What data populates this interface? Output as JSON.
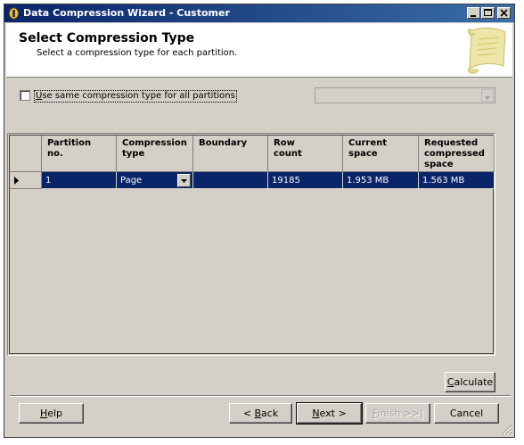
{
  "window": {
    "title": "Data Compression Wizard - Customer",
    "controls": [
      "minimize-icon",
      "maximize-icon",
      "close-icon"
    ]
  },
  "header": {
    "title": "Select Compression Type",
    "subtitle": "Select a compression type for each partition.",
    "art_icon": "scroll-icon"
  },
  "options": {
    "same_type_label_u": "U",
    "same_type_label_rest": "se same compression type for all partitions",
    "same_type_checked": false,
    "all_partitions_type": ""
  },
  "grid": {
    "columns": [
      "Partition\nno.",
      "Compression\ntype",
      "Boundary",
      "Row\ncount",
      "Current\nspace",
      "Requested\ncompressed\nspace"
    ],
    "rows": [
      {
        "partition_no": "1",
        "compression_type": "Page",
        "boundary": "",
        "row_count": "19185",
        "current_space": "1.953 MB",
        "requested_space": "1.563 MB"
      }
    ]
  },
  "buttons": {
    "calculate_u": "C",
    "calculate_rest": "alculate",
    "help_u": "H",
    "help_rest": "elp",
    "back_pre": "< ",
    "back_u": "B",
    "back_rest": "ack",
    "next_u": "N",
    "next_rest": "ext >",
    "finish_u": "F",
    "finish_rest": "inish >>|",
    "cancel": "Cancel"
  },
  "colors": {
    "title_bar": "#0a246a",
    "selection": "#0a246a",
    "face": "#d4d0c8"
  }
}
